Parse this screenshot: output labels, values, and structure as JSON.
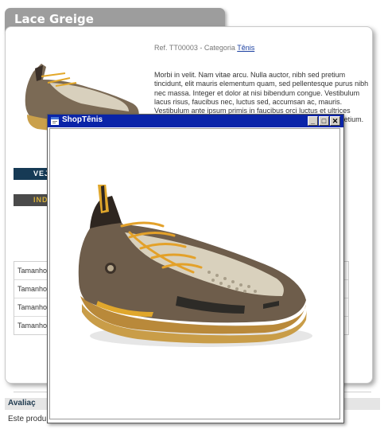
{
  "product": {
    "title": "Lace Greige",
    "ref_prefix": "Ref. TT00003 - Categoria ",
    "category_link": "Tênis",
    "description": "Morbi in velit. Nam vitae arcu. Nulla auctor, nibh sed pretium tincidunt, elit mauris elementum quam, sed pellentesque purus nibh nec massa. Integer et dolor at nisi bibendum congue. Vestibulum lacus risus, faucibus nec, luctus sed, accumsan ac, mauris. Vestibulum ante ipsum primis in faucibus orci luctus et ultrices posuere cubilia Curae; Cras ut sapien ac nulla sollicitudin pretium. Sed nec ligula. Sed nec ligula nec magna ultricies vehicula."
  },
  "buttons": {
    "view_label": "VEJ",
    "indicate_label": "IND"
  },
  "sizes": {
    "rows": [
      {
        "label": "Tamanho"
      },
      {
        "label": "Tamanho"
      },
      {
        "label": "Tamanho"
      },
      {
        "label": "Tamanho"
      }
    ]
  },
  "evaluation": {
    "heading": "Avaliaç",
    "text": "Este produ"
  },
  "popup": {
    "title": "ShopTênis",
    "minimize_glyph": "_",
    "maximize_glyph": "□",
    "close_glyph": "✕"
  },
  "colors": {
    "titlebar": "#0a24a8",
    "tab_gray": "#9d9d9d",
    "btn_dark": "#163a55",
    "btn_gray_text": "#d9b23a"
  }
}
